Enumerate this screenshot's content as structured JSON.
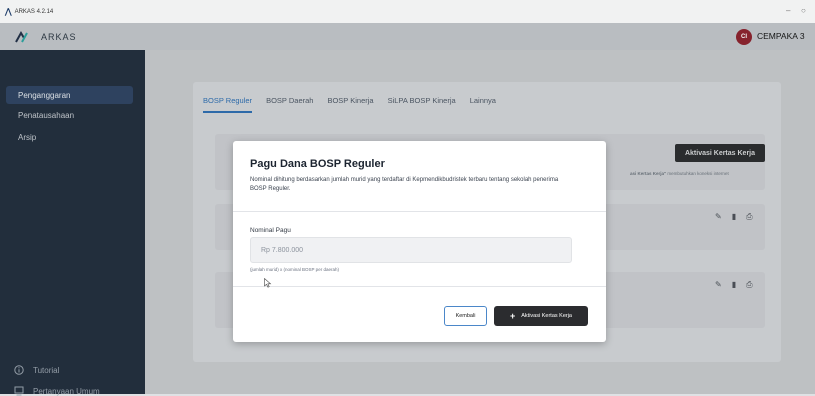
{
  "window": {
    "title": "ARKAS 4.2.14",
    "minimize": "–",
    "restore": "○"
  },
  "header": {
    "brand": "ARKAS",
    "avatar_initials": "CI",
    "school_name": "CEMPAKA 3"
  },
  "sidebar": {
    "items": [
      {
        "label": "Penganggaran",
        "active": true
      },
      {
        "label": "Penatausahaan",
        "active": false
      },
      {
        "label": "Arsip",
        "active": false
      }
    ],
    "bottom": [
      {
        "label": "Tutorial",
        "icon": "info-icon"
      },
      {
        "label": "Pertanyaan Umum",
        "icon": "faq-icon"
      }
    ]
  },
  "tabs": [
    {
      "label": "BOSP Reguler",
      "active": true
    },
    {
      "label": "BOSP Daerah",
      "active": false
    },
    {
      "label": "BOSP Kinerja",
      "active": false
    },
    {
      "label": "SiLPA BOSP Kinerja",
      "active": false
    },
    {
      "label": "Lainnya",
      "active": false
    }
  ],
  "background": {
    "activate_button": "Aktivasi Kertas Kerja",
    "note_bold": "asi Kertas Kerja\"",
    "note_rest": " membutuhkan koneksi internet"
  },
  "dialog": {
    "title": "Pagu Dana BOSP Reguler",
    "description": "Nominal dihitung berdasarkan jumlah murid yang terdaftar di Kepmendikbudristek terbaru tentang sekolah penerima BOSP Reguler.",
    "field_label": "Nominal Pagu",
    "field_value": "Rp 7.800.000",
    "field_hint": "(jumlah murid) x (nominal BOSP per daerah)",
    "back_button": "Kembali",
    "activate_button": "Aktivasi Kertas Kerja"
  },
  "colors": {
    "sidebar_bg": "#1f2b3a",
    "accent": "#2b6cb0",
    "avatar": "#8b1e2a",
    "primary_button": "#2b2c2f"
  }
}
